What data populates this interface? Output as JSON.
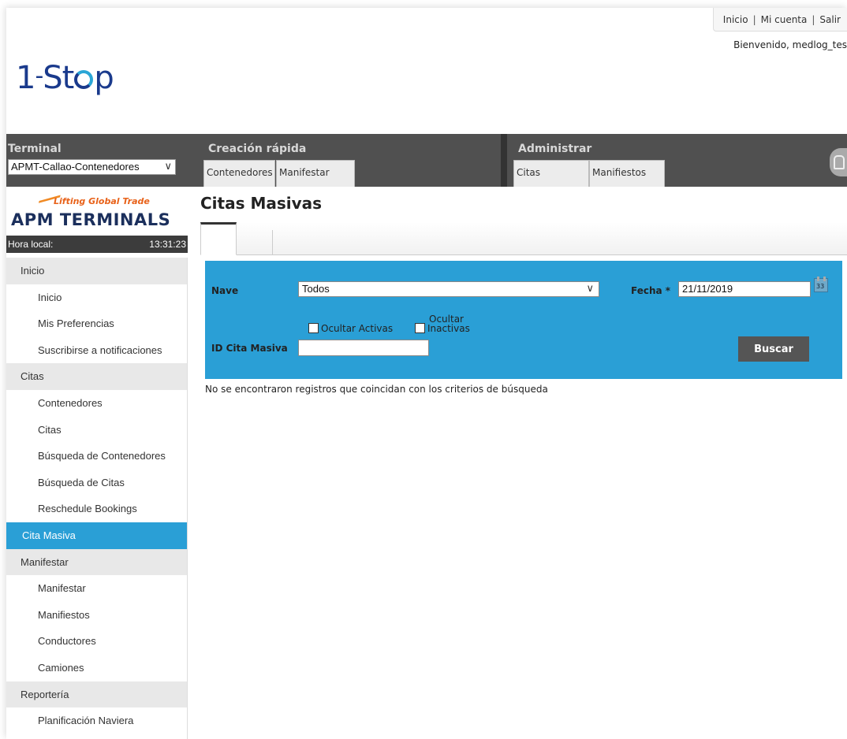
{
  "header": {
    "top_links": [
      "Inicio",
      "Mi cuenta",
      "Salir"
    ],
    "welcome": "Bienvenido, medlog_tes",
    "logo_text_left": "1",
    "logo_text_mid": "St",
    "logo_text_right": "p"
  },
  "menubar": {
    "terminal": {
      "title": "Terminal",
      "selected": "APMT-Callao-Contenedores"
    },
    "quick": {
      "title": "Creación rápida",
      "items": [
        "Contenedores",
        "Manifestar"
      ]
    },
    "admin": {
      "title": "Administrar",
      "items": [
        "Citas",
        "Manifiestos"
      ]
    }
  },
  "brand": {
    "tagline": "Lifting Global Trade",
    "name": "APM TERMINALS",
    "hora_label": "Hora local:",
    "hora_value": "13:31:23"
  },
  "sidebar": {
    "sections": [
      {
        "label": "Inicio",
        "items": [
          "Inicio",
          "Mis Preferencias",
          "Suscribirse a notificaciones"
        ]
      },
      {
        "label": "Citas",
        "items": [
          "Contenedores",
          "Citas",
          "Búsqueda de Contenedores",
          "Búsqueda de Citas",
          "Reschedule Bookings"
        ]
      },
      {
        "label": "Cita Masiva",
        "active": true,
        "items": []
      },
      {
        "label": "Manifestar",
        "items": [
          "Manifestar",
          "Manifiestos",
          "Conductores",
          "Camiones"
        ]
      },
      {
        "label": "Reportería",
        "items": [
          "Planificación Naviera"
        ]
      }
    ]
  },
  "main": {
    "title": "Citas Masivas",
    "form": {
      "nave_label": "Nave",
      "nave_value": "Todos",
      "fecha_label": "Fecha *",
      "fecha_value": "21/11/2019",
      "calendar_num": "33",
      "ocultar_activas": "Ocultar Activas",
      "ocultar_inactivas_line1": "Ocultar",
      "ocultar_inactivas_line2": "Inactivas",
      "id_label": "ID Cita Masiva",
      "id_value": "",
      "buscar_label": "Buscar"
    },
    "no_results": "No se encontraron registros que coincidan con los criterios de búsqueda"
  },
  "colors": {
    "accent_blue": "#2a9fd6",
    "menubar": "#505050",
    "logo_blue": "#1a3a8c",
    "apm_orange": "#e8621a",
    "button_dark": "#555555"
  }
}
